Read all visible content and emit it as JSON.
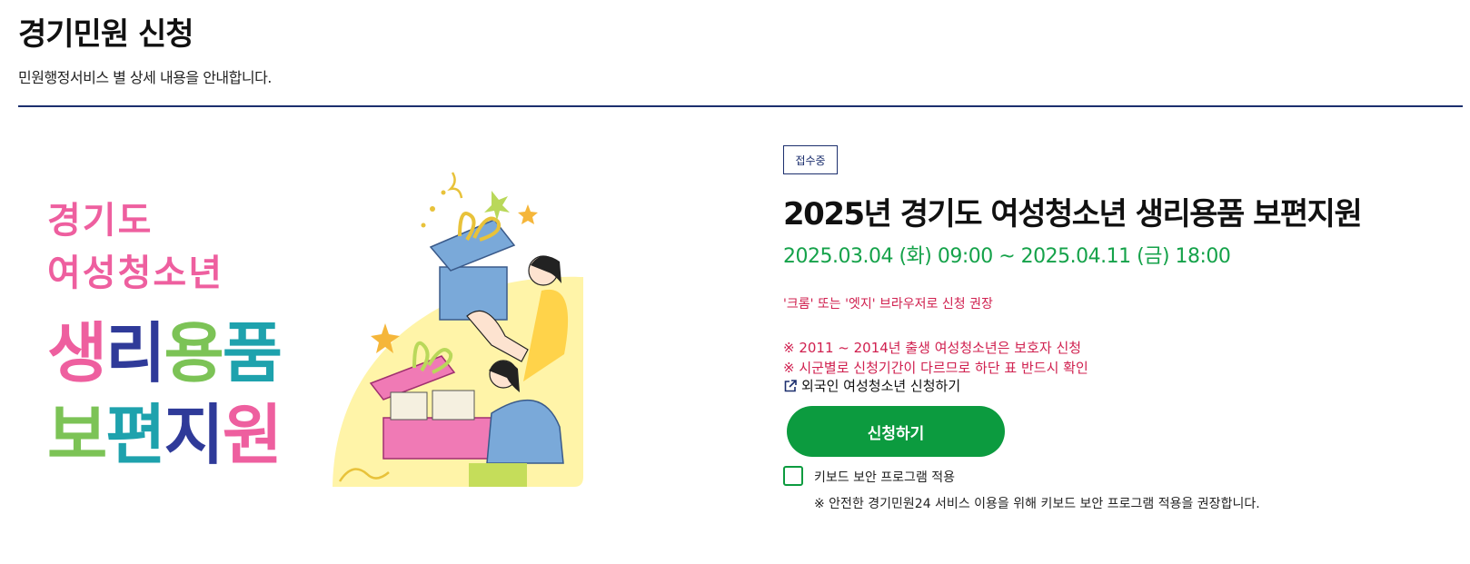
{
  "header": {
    "title": "경기민원 신청",
    "subtitle": "민원행정서비스 별 상세 내용을 안내합니다."
  },
  "banner": {
    "line1": "경기도",
    "line2": "여성청소년",
    "line3": [
      "생",
      "리",
      "용",
      "품"
    ],
    "line4": [
      "보",
      "편",
      "지",
      "원"
    ],
    "colors": {
      "pink": "#ee5f9f",
      "navy": "#2f3a99",
      "green": "#7cc356",
      "teal": "#1ea2ad",
      "yellow_bg": "#fff4a8"
    }
  },
  "detail": {
    "status_badge": "접수중",
    "title": "2025년 경기도 여성청소년 생리용품 보편지원",
    "period": "2025.03.04 (화) 09:00 ~ 2025.04.11 (금) 18:00",
    "browser_notice": "'크롬' 또는 '엣지' 브라우저로 신청 권장",
    "notices": [
      "※ 2011 ~ 2014년 출생 여성청소년은 보호자 신청",
      "※ 시군별로 신청기간이 다르므로 하단 표 반드시 확인"
    ],
    "foreign_link": "외국인 여성청소년 신청하기",
    "apply_button": "신청하기",
    "keyboard_security_label": "키보드 보안 프로그램 적용",
    "keyboard_security_notice": "※ 안전한 경기민원24 서비스 이용을 위해 키보드 보안 프로그램 적용을 권장합니다.",
    "keyboard_security_checked": false
  },
  "colors": {
    "accent_green": "#0c9b3f",
    "period_green": "#15a24a",
    "notice_red": "#d0204f",
    "navy": "#1c2f6e"
  }
}
